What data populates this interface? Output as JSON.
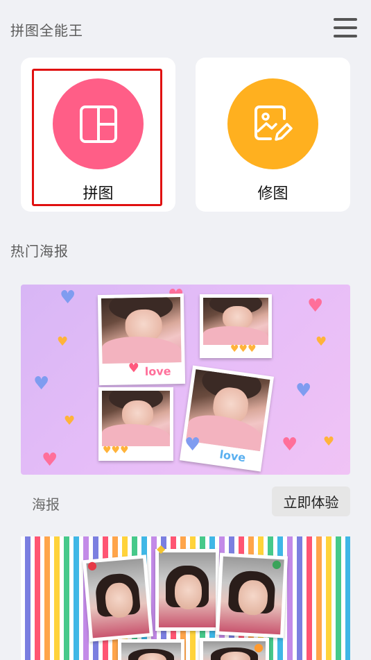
{
  "header": {
    "title": "拼图全能王",
    "menu_icon": "hamburger-menu-icon"
  },
  "tools": [
    {
      "label": "拼图",
      "icon": "collage-layout-icon",
      "color": "#ff5e87",
      "selected": true
    },
    {
      "label": "修图",
      "icon": "photo-edit-icon",
      "color": "#ffb01f",
      "selected": false
    }
  ],
  "section": {
    "title": "热门海报"
  },
  "posters": [
    {
      "label": "海报",
      "button_label": "立即体验",
      "overlay_texts": [
        "love",
        "love"
      ]
    }
  ],
  "colors": {
    "background": "#f0f1f5",
    "card": "#ffffff",
    "highlight": "#e01010",
    "button_bg": "#e6e6e6"
  }
}
